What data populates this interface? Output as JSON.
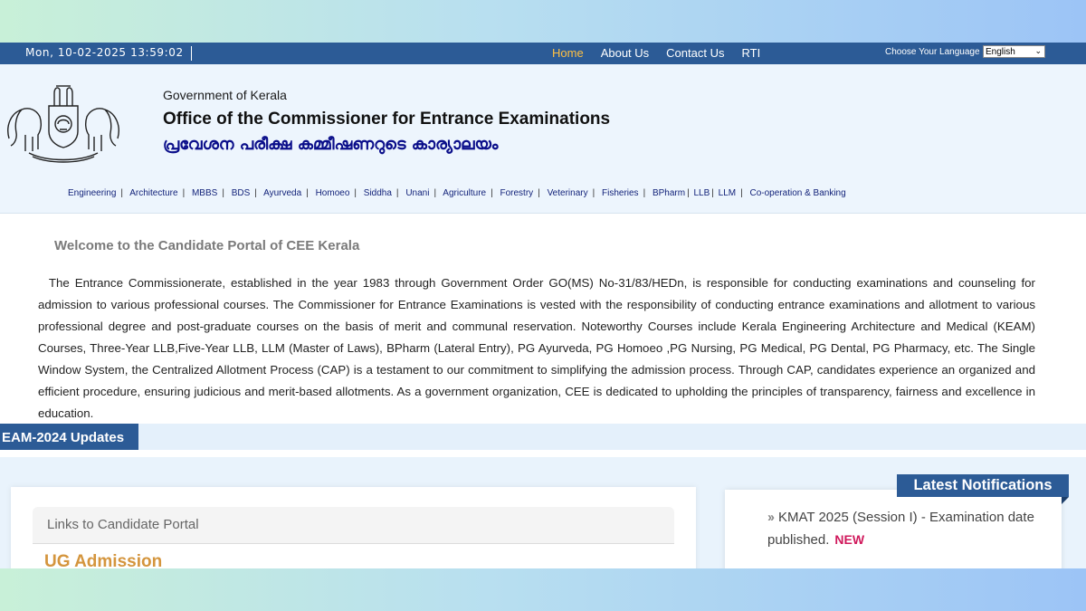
{
  "topbar": {
    "datetime": "Mon, 10-02-2025 13:59:02",
    "nav": [
      {
        "label": "Home",
        "active": true
      },
      {
        "label": "About Us",
        "active": false
      },
      {
        "label": "Contact Us",
        "active": false
      },
      {
        "label": "RTI",
        "active": false
      }
    ],
    "language_label": "Choose Your Language",
    "language_selected": "English"
  },
  "header": {
    "gov": "Government of Kerala",
    "office": "Office of the Commissioner for Entrance Examinations",
    "malayalam": "പ്രവേശന പരീക്ഷ കമ്മീഷണറുടെ കാര്യാലയം",
    "courses": [
      "Engineering",
      "Architecture",
      "MBBS",
      "BDS",
      "Ayurveda",
      "Homoeo",
      "Siddha",
      "Unani",
      "Agriculture",
      "Forestry",
      "Veterinary",
      "Fisheries",
      "BPharm",
      "LLB",
      "LLM",
      "Co-operation & Banking"
    ]
  },
  "welcome": {
    "title": "Welcome to the Candidate Portal of CEE Kerala",
    "body": "The Entrance Commissionerate, established in the year 1983 through Government Order GO(MS) No-31/83/HEDn, is responsible for conducting examinations and counseling for admission to various professional courses. The Commissioner for Entrance Examinations is vested with the responsibility of conducting entrance examinations and allotment to various professional degree and post-graduate courses on the basis of merit and communal reservation. Noteworthy Courses include Kerala Engineering Architecture and Medical (KEAM) Courses, Three-Year LLB,Five-Year LLB, LLM (Master of Laws), BPharm (Lateral Entry), PG Ayurveda, PG Homoeo ,PG Nursing, PG Medical, PG Dental, PG Pharmacy, etc. The Single Window System, the Centralized Allotment Process (CAP) is a testament to our commitment to simplifying the admission process. Through CAP, candidates experience an organized and efficient procedure, ensuring judicious and merit-based allotments. As a government organization, CEE is dedicated to upholding the principles of transparency, fairness and excellence in education."
  },
  "updates": {
    "label": "EAM-2024 Updates"
  },
  "portal": {
    "heading": "Links to Candidate Portal",
    "ug": "UG Admission"
  },
  "notifications": {
    "title": "Latest Notifications",
    "items": [
      {
        "text": "KMAT 2025 (Session I) - Examination date published.",
        "badge": "NEW"
      }
    ]
  },
  "colors": {
    "primary": "#2c5b96",
    "accent": "#ffc043",
    "ug": "#d4953d",
    "new_badge": "#d0195c"
  }
}
